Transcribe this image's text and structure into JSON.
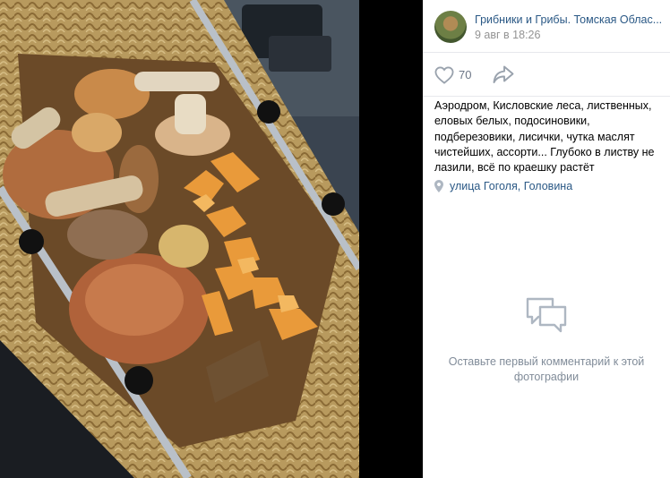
{
  "group": {
    "name": "Грибники и Грибы. Томская Облас...",
    "date": "9 авг в 18:26"
  },
  "actions": {
    "like_icon": "heart-icon",
    "like_count": "70",
    "share_icon": "share-arrow-icon"
  },
  "caption": "Аэродром, Кисловские леса, лиственных, еловых белых, подосиновики, подберезовики, лисички, чутка маслят чистейших, ассорти... Глубоко в листву не лазили, всё по краешку растёт",
  "location": {
    "icon": "map-pin-icon",
    "text": "улица Гоголя, Головина"
  },
  "comments": {
    "icon": "comment-bubbles-icon",
    "empty_text": "Оставьте первый комментарий к этой фотографии"
  },
  "colors": {
    "link": "#2a5885",
    "muted": "#939393",
    "icon_gray": "#aeb7c2",
    "photo_bg": "#000000"
  }
}
